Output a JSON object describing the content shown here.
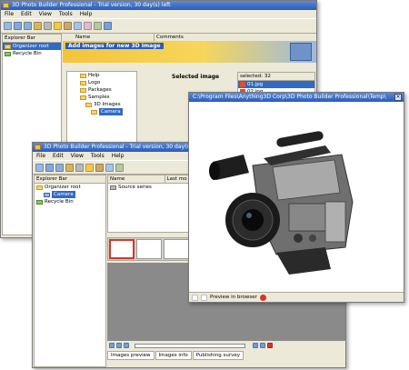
{
  "back_window": {
    "title": "3D Photo Builder Professional - Trial version, 30 day(s) left",
    "menu": [
      "File",
      "Edit",
      "View",
      "Tools",
      "Help"
    ],
    "explorer_header": "Explorer Bar",
    "explorer_items": [
      "Organizer root",
      "Recycle Bin"
    ],
    "list_headers": [
      "Name",
      "Comments"
    ],
    "wizard_title": "Add images for new 3D Image",
    "tree": [
      "Help",
      "Logo",
      "Packages",
      "Samples",
      "3D Images",
      "Camera"
    ],
    "selected_image_label": "Selected image",
    "file_list_header": "selected: 32",
    "files": [
      "01.jpg",
      "02.jpg"
    ]
  },
  "mid_window": {
    "title": "3D Photo Builder Professional - Trial version, 30 day(s) left",
    "menu": [
      "File",
      "Edit",
      "View",
      "Tools",
      "Help"
    ],
    "explorer_header": "Explorer Bar",
    "explorer_items": [
      "Organizer root",
      "Camera",
      "Recycle Bin"
    ],
    "list_headers": [
      "Name",
      "Last mo"
    ],
    "list_items": [
      "Source series"
    ],
    "tabs": [
      "Images preview",
      "Images info",
      "Publishing survey"
    ]
  },
  "front_window": {
    "title": "C:\\Program Files\\Anything3D Corp\\3D Photo Builder Professional\\Temp\\",
    "preview_label": "Preview in browser"
  },
  "colors": {
    "titlebar": "#2a5bb8",
    "selection": "#316ac5",
    "window_face": "#ece9d8"
  }
}
